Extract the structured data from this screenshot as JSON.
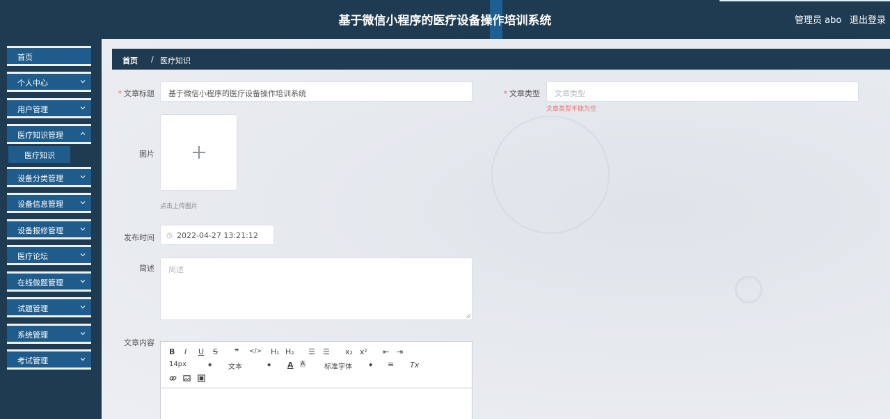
{
  "header": {
    "title": "基于微信小程序的医疗设备操作培训系统",
    "user": "管理员 abo",
    "logout": "退出登录"
  },
  "sidebar": {
    "items": [
      {
        "label": "首页"
      },
      {
        "label": "个人中心"
      },
      {
        "label": "用户管理"
      },
      {
        "label": "医疗知识管理"
      },
      {
        "label": "设备分类管理"
      },
      {
        "label": "设备信息管理"
      },
      {
        "label": "设备报修管理"
      },
      {
        "label": "医疗论坛"
      },
      {
        "label": "在线做题管理"
      },
      {
        "label": "试题管理"
      },
      {
        "label": "系统管理"
      },
      {
        "label": "考试管理"
      }
    ],
    "sub_item": "医疗知识"
  },
  "breadcrumb": {
    "home": "首页",
    "sep": "/",
    "current": "医疗知识"
  },
  "form": {
    "title_label": "文章标题",
    "title_value": "基于微信小程序的医疗设备操作培训系统",
    "type_label": "文章类型",
    "type_placeholder": "文章类型",
    "type_error": "文章类型不能为空",
    "image_label": "图片",
    "image_hint": "点击上传图片",
    "time_label": "发布时间",
    "time_value": "2022-04-27 13:21:12",
    "summary_label": "简述",
    "summary_placeholder": "简述",
    "content_label": "文章内容"
  },
  "editor": {
    "bold": "B",
    "italic": "I",
    "underline": "U",
    "strike": "S",
    "quote": "❞",
    "code": "</>",
    "h1": "H₁",
    "h2": "H₂",
    "ordered_list": "☰",
    "bullet_list": "☰",
    "sub": "x₂",
    "sup": "x²",
    "outdent": "⇤",
    "indent": "⇥",
    "size": "14px",
    "header": "文本",
    "color": "A",
    "background": "A",
    "font": "标准字体",
    "align": "≡",
    "clean": "Tx"
  },
  "colors": {
    "nav": "#1f3b52",
    "menu": "#1f5c8c",
    "error": "#f56c6c"
  }
}
